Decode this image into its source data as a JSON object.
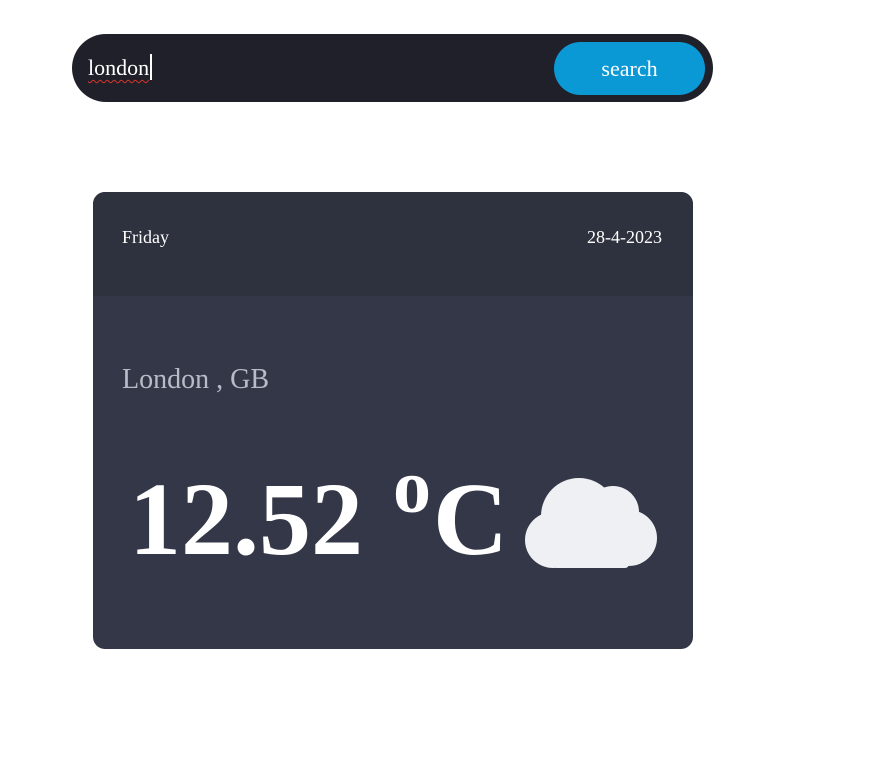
{
  "search": {
    "value": "london",
    "button_label": "search"
  },
  "weather": {
    "day": "Friday",
    "date": "28-4-2023",
    "location": "London , GB",
    "temperature": "12.52",
    "degree_symbol": "o",
    "unit": "C",
    "condition_icon": "cloud-icon"
  },
  "colors": {
    "search_bar_bg": "#1f2029",
    "search_button": "#0b99d6",
    "card_bg": "#343747",
    "card_header_bg": "#2e313e",
    "location_text": "#b9bcc8",
    "cloud": "#eff0f4"
  }
}
